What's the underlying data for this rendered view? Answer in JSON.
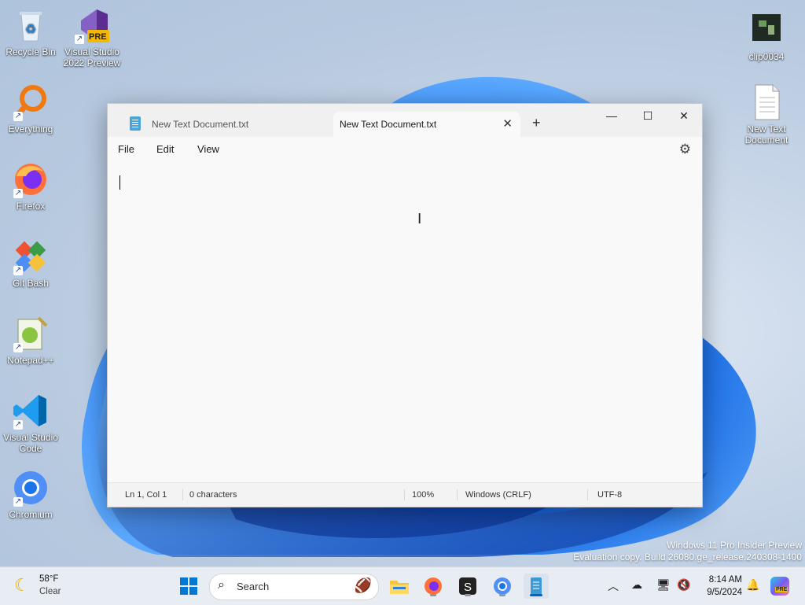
{
  "desktop": {
    "icons_left": [
      {
        "name": "recycle-bin",
        "label": "Recycle Bin"
      },
      {
        "name": "visual-studio-2022-preview",
        "label": "Visual Studio 2022 Preview",
        "badge": "PRE"
      },
      {
        "name": "everything",
        "label": "Everything"
      },
      {
        "name": "firefox",
        "label": "Firefox"
      },
      {
        "name": "git-bash",
        "label": "Git Bash"
      },
      {
        "name": "notepad-plus-plus",
        "label": "Notepad++"
      },
      {
        "name": "visual-studio-code",
        "label": "Visual Studio Code"
      },
      {
        "name": "chromium",
        "label": "Chromium"
      }
    ],
    "icons_right": [
      {
        "name": "clip0034",
        "label": "clip0034"
      },
      {
        "name": "new-text-document",
        "label": "New Text Document"
      }
    ],
    "watermark": {
      "line1": "Windows 11 Pro Insider Preview",
      "line2": "Evaluation copy. Build 26080.ge_release.240308-1400"
    }
  },
  "notepad": {
    "tabs": [
      {
        "label": "New Text Document.txt",
        "active": false
      },
      {
        "label": "New Text Document.txt",
        "active": true
      }
    ],
    "new_tab": "+",
    "controls": {
      "minimize": "—",
      "maximize": "☐",
      "close": "✕"
    },
    "menu": {
      "file": "File",
      "edit": "Edit",
      "view": "View"
    },
    "status": {
      "position": "Ln 1, Col 1",
      "characters": "0 characters",
      "zoom": "100%",
      "line_ending": "Windows (CRLF)",
      "encoding": "UTF-8"
    }
  },
  "taskbar": {
    "weather": {
      "temp": "58°F",
      "condition": "Clear"
    },
    "search_label": "Search",
    "clock": {
      "time": "8:14 AM",
      "date": "9/5/2024"
    },
    "copilot_badge": "PRE"
  }
}
